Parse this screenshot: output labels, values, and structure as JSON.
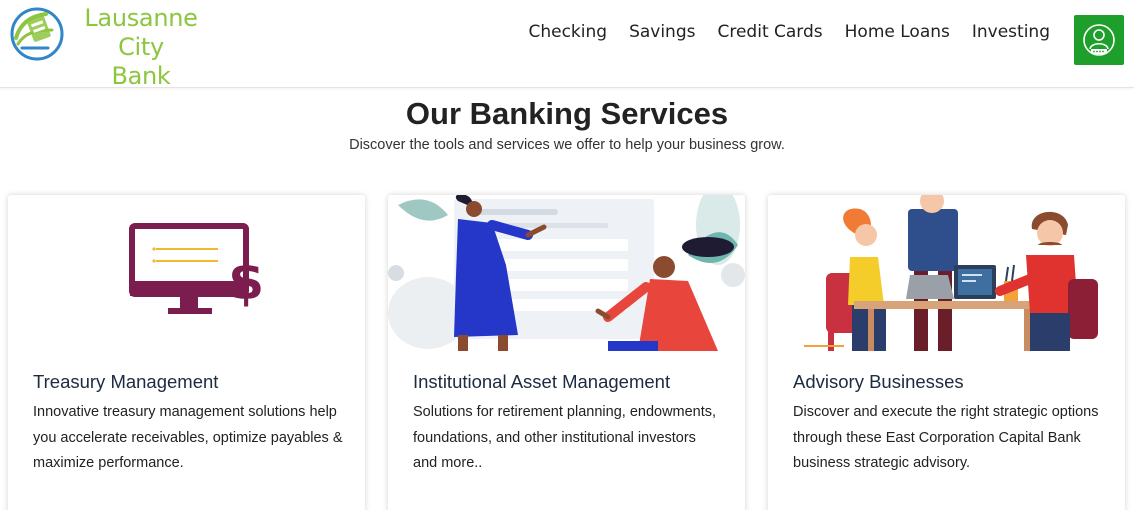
{
  "brand": {
    "line1": "Lausanne City",
    "line2": "Bank",
    "color": "#8cc63f"
  },
  "nav": {
    "items": [
      "Checking",
      "Savings",
      "Credit Cards",
      "Home Loans",
      "Investing"
    ],
    "user_icon": "user-lock-icon",
    "user_button_color": "#1e9e2a"
  },
  "hero": {
    "title": "Our Banking Services",
    "subtitle": "Discover the tools and services we offer to help your business grow."
  },
  "cards": [
    {
      "icon": "monitor-dollar-icon",
      "title": "Treasury Management",
      "text": "Innovative treasury management solutions help you accelerate receivables, optimize payables & maximize performance."
    },
    {
      "icon": "asset-management-illustration",
      "title": "Institutional Asset Management",
      "text": "Solutions for retirement planning, endowments, foundations, and other institutional investors and more.."
    },
    {
      "icon": "advisory-team-illustration",
      "title": "Advisory Businesses",
      "text": "Discover and execute the right strategic options through these East Corporation Capital Bank business strategic advisory."
    }
  ]
}
